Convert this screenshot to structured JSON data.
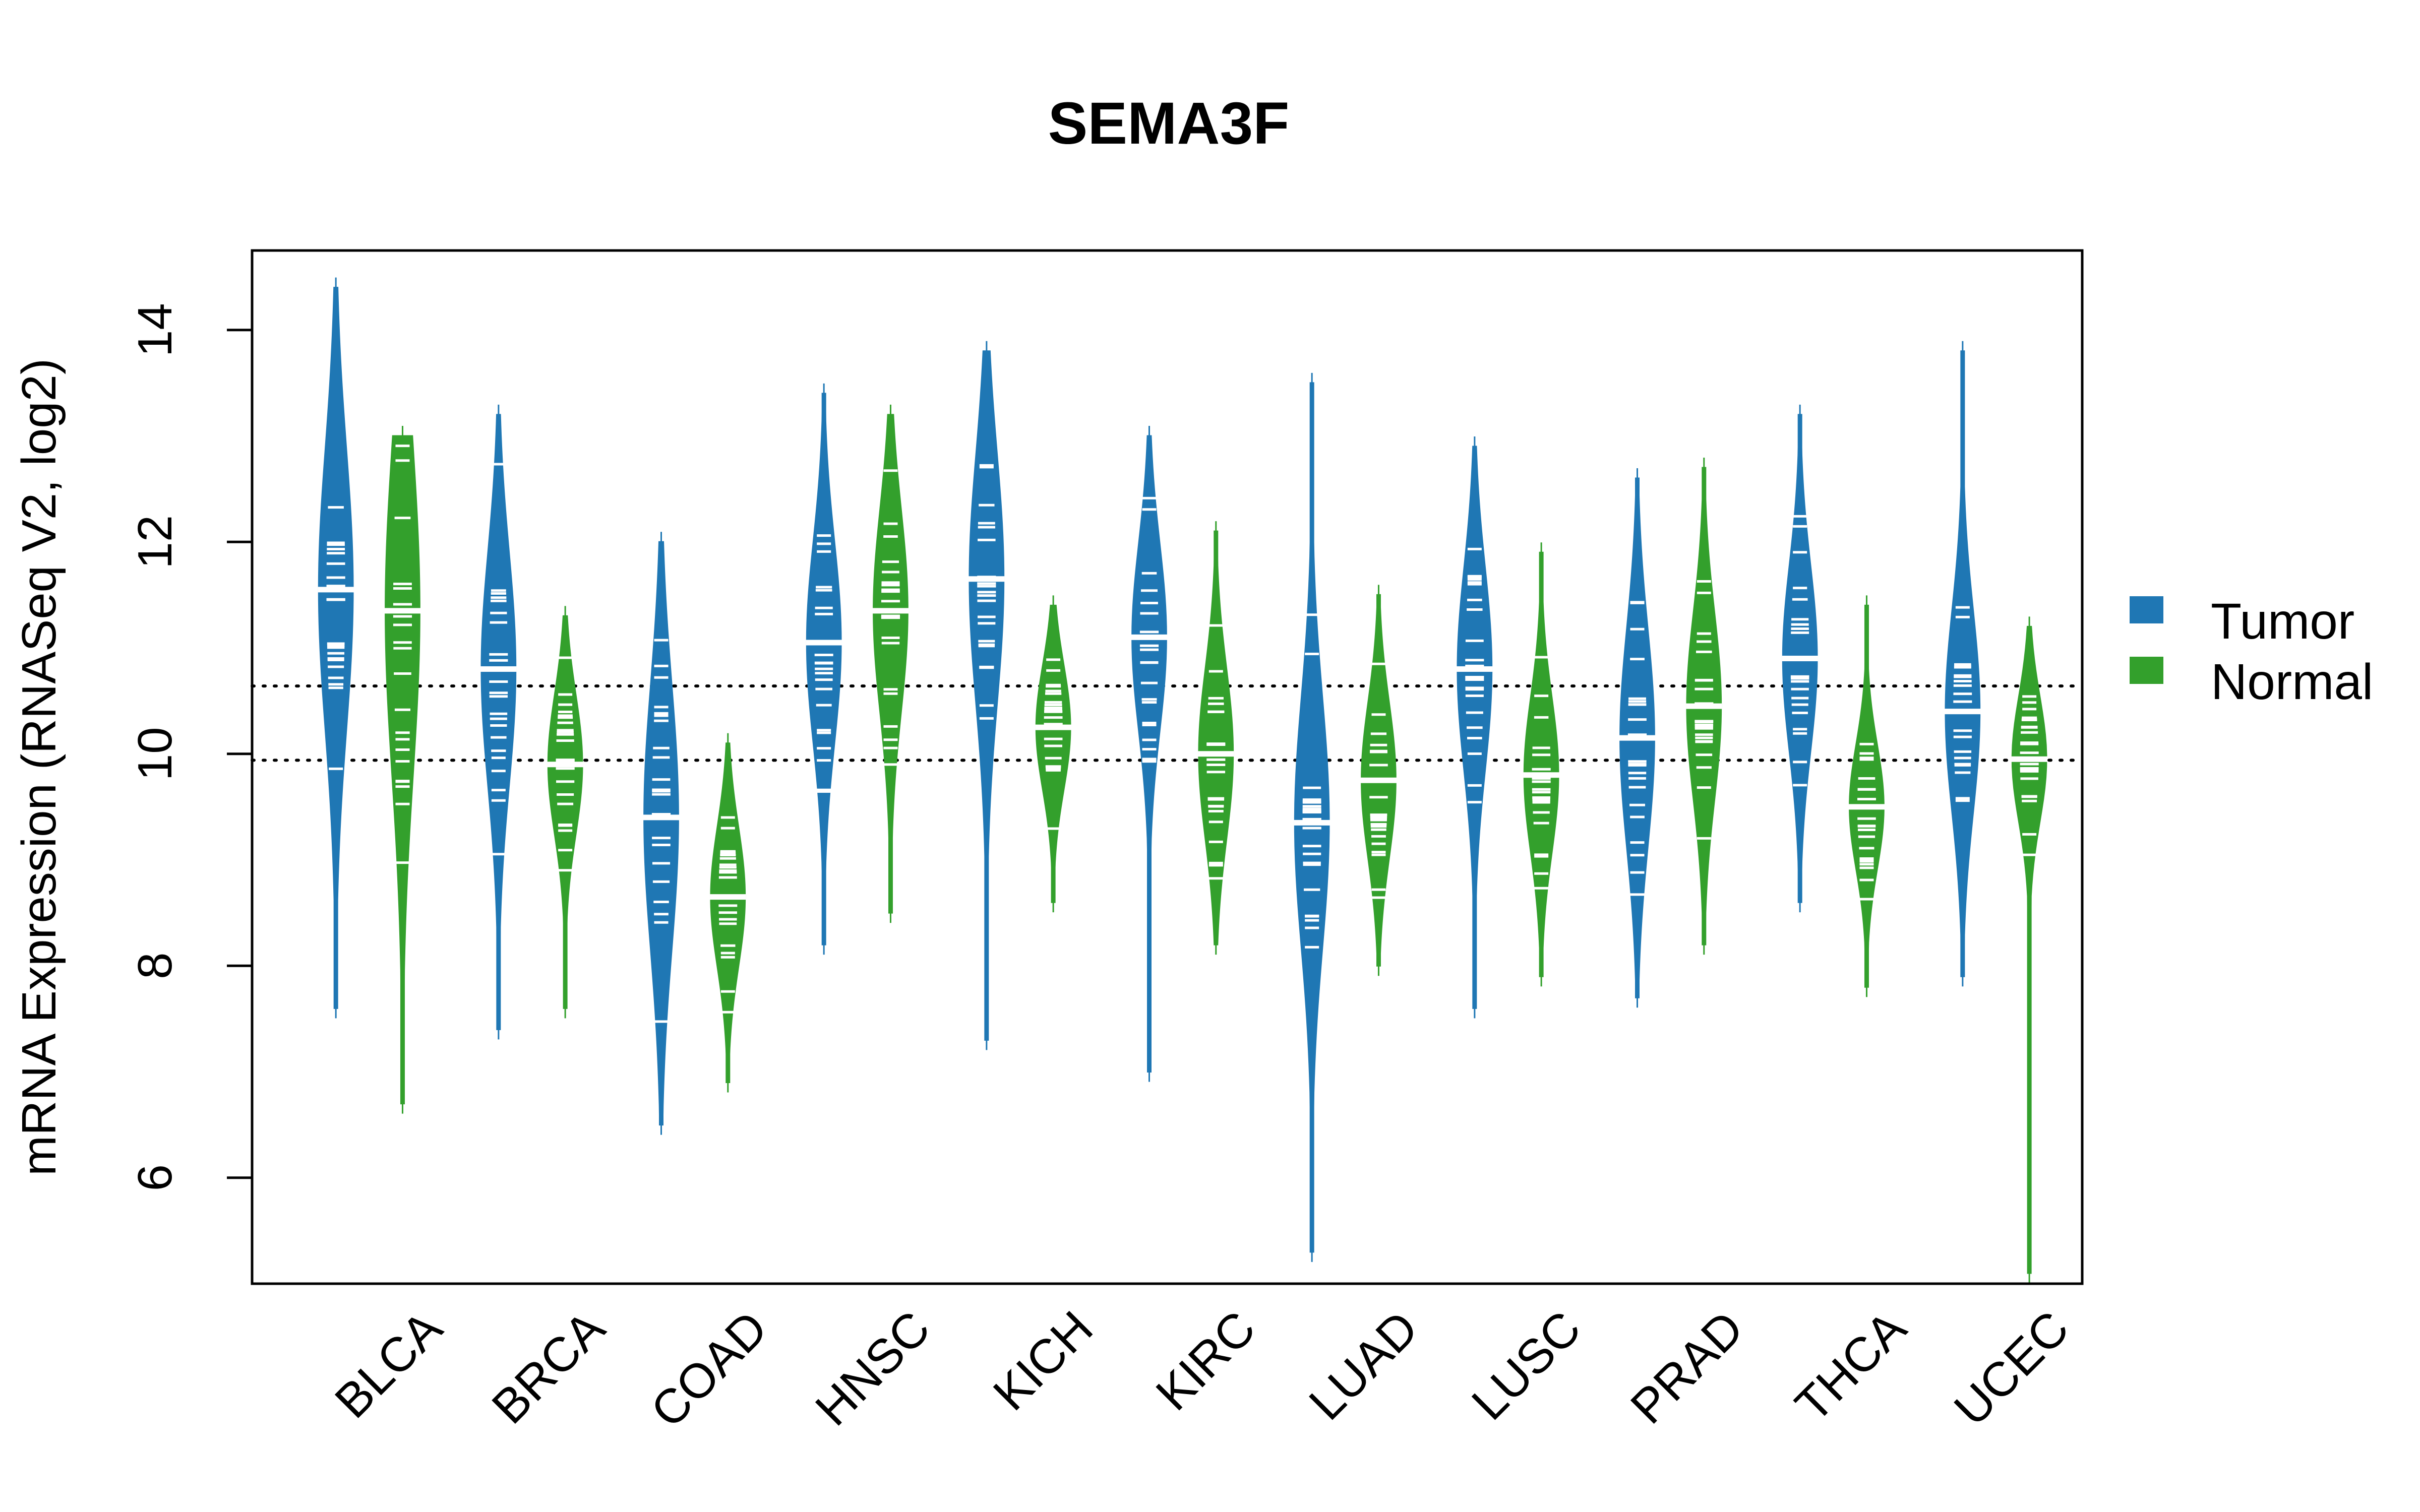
{
  "chart_data": {
    "type": "beanplot",
    "title": "SEMA3F",
    "xlabel": "",
    "ylabel": "mRNA Expression (RNASeq V2, log2)",
    "ylim": [
      5.0,
      14.75
    ],
    "yticks": [
      6,
      8,
      10,
      12,
      14
    ],
    "grid": false,
    "legend_position": "right",
    "reference_lines": [
      10.64,
      9.94
    ],
    "categories": [
      "BLCA",
      "BRCA",
      "COAD",
      "HNSC",
      "KICH",
      "KIRC",
      "LUAD",
      "LUSC",
      "PRAD",
      "THCA",
      "UCEC"
    ],
    "series": [
      {
        "name": "Tumor",
        "color": "#1f77b4",
        "median": [
          11.55,
          10.8,
          9.4,
          11.05,
          11.65,
          11.1,
          9.35,
          10.8,
          10.15,
          10.9,
          10.4
        ],
        "min": [
          7.6,
          7.4,
          6.5,
          8.2,
          7.3,
          7.0,
          5.3,
          7.6,
          7.7,
          8.6,
          7.9
        ],
        "max": [
          14.4,
          13.2,
          12.0,
          13.4,
          13.8,
          13.0,
          13.5,
          12.9,
          12.6,
          13.2,
          13.8
        ],
        "q1": [
          10.6,
          10.1,
          8.6,
          10.4,
          10.9,
          10.5,
          8.6,
          10.2,
          9.5,
          10.4,
          9.8
        ],
        "q3": [
          12.4,
          11.6,
          10.3,
          11.7,
          12.5,
          11.7,
          10.2,
          11.5,
          10.9,
          11.6,
          11.1
        ]
      },
      {
        "name": "Normal",
        "color": "#33a02c",
        "median": [
          11.35,
          9.9,
          8.65,
          11.35,
          10.25,
          10.0,
          9.75,
          9.8,
          10.45,
          9.5,
          9.95
        ],
        "min": [
          6.7,
          7.6,
          6.9,
          8.5,
          8.6,
          8.2,
          8.0,
          7.9,
          8.2,
          7.8,
          5.1
        ],
        "max": [
          13.0,
          11.3,
          10.1,
          13.2,
          11.4,
          12.1,
          11.5,
          11.9,
          12.7,
          11.4,
          11.2
        ],
        "q1": [
          10.0,
          9.4,
          8.2,
          10.7,
          9.8,
          9.4,
          9.2,
          9.3,
          9.9,
          9.1,
          9.5
        ],
        "q3": [
          12.1,
          10.3,
          9.1,
          12.0,
          10.6,
          10.5,
          10.2,
          10.3,
          11.1,
          9.9,
          10.3
        ]
      }
    ]
  },
  "legend": {
    "items": [
      {
        "label": "Tumor",
        "color": "#1f77b4"
      },
      {
        "label": "Normal",
        "color": "#33a02c"
      }
    ]
  }
}
